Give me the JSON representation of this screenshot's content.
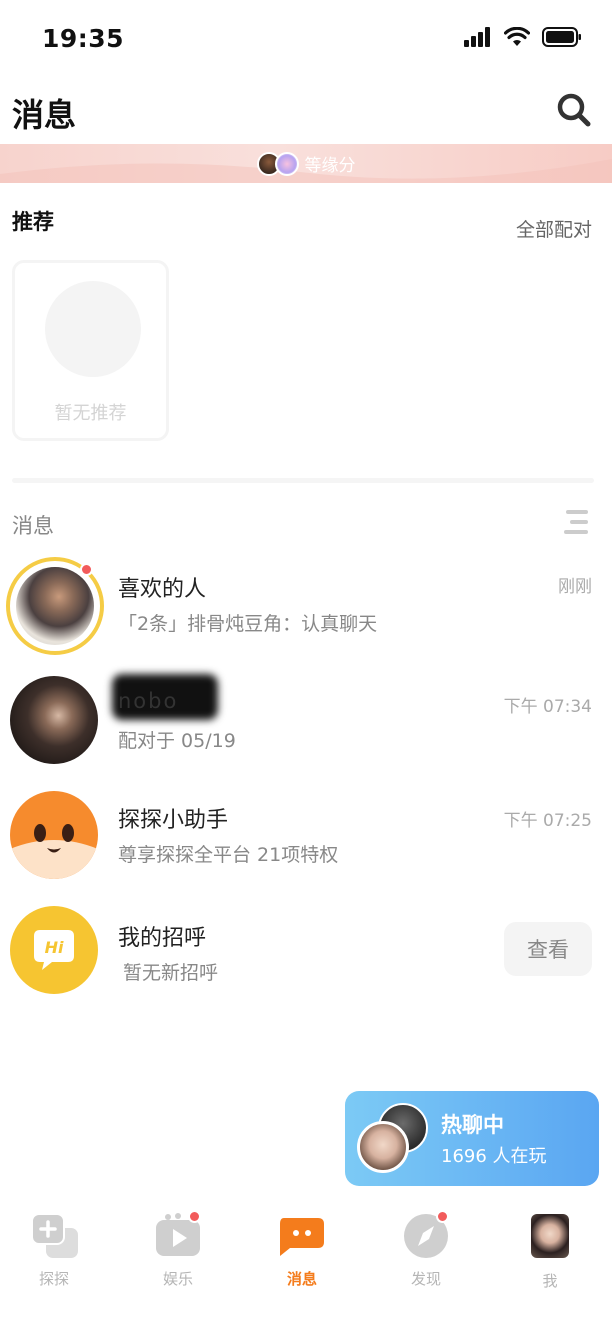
{
  "status_bar": {
    "time": "19:35"
  },
  "header": {
    "title": "消息"
  },
  "banner": {
    "text": "等缘分"
  },
  "recommend": {
    "title": "推荐",
    "all_match": "全部配对",
    "empty_text": "暂无推荐"
  },
  "messages": {
    "title": "消息",
    "items": [
      {
        "name": "喜欢的人",
        "preview": "「2条」排骨炖豆角：认真聊天",
        "time": "刚刚"
      },
      {
        "name": "nobo",
        "preview": "配对于 05/19",
        "time": "下午 07:34"
      },
      {
        "name": "探探小助手",
        "preview": "尊享探探全平台 21项特权",
        "time": "下午 07:25"
      },
      {
        "name": "我的招呼",
        "preview": "暂无新招呼",
        "action": "查看"
      }
    ]
  },
  "hot_chat": {
    "title": "热聊中",
    "subtitle": "1696 人在玩"
  },
  "tabs": [
    {
      "label": "探探",
      "icon": "tantan-icon"
    },
    {
      "label": "娱乐",
      "icon": "play-icon"
    },
    {
      "label": "消息",
      "icon": "chat-icon"
    },
    {
      "label": "发现",
      "icon": "compass-icon"
    },
    {
      "label": "我",
      "icon": "profile-avatar"
    }
  ],
  "colors": {
    "accent": "#f47c1c",
    "badge": "#f25b5b",
    "ring": "#f5cc45",
    "hi_yellow": "#f6c531"
  }
}
